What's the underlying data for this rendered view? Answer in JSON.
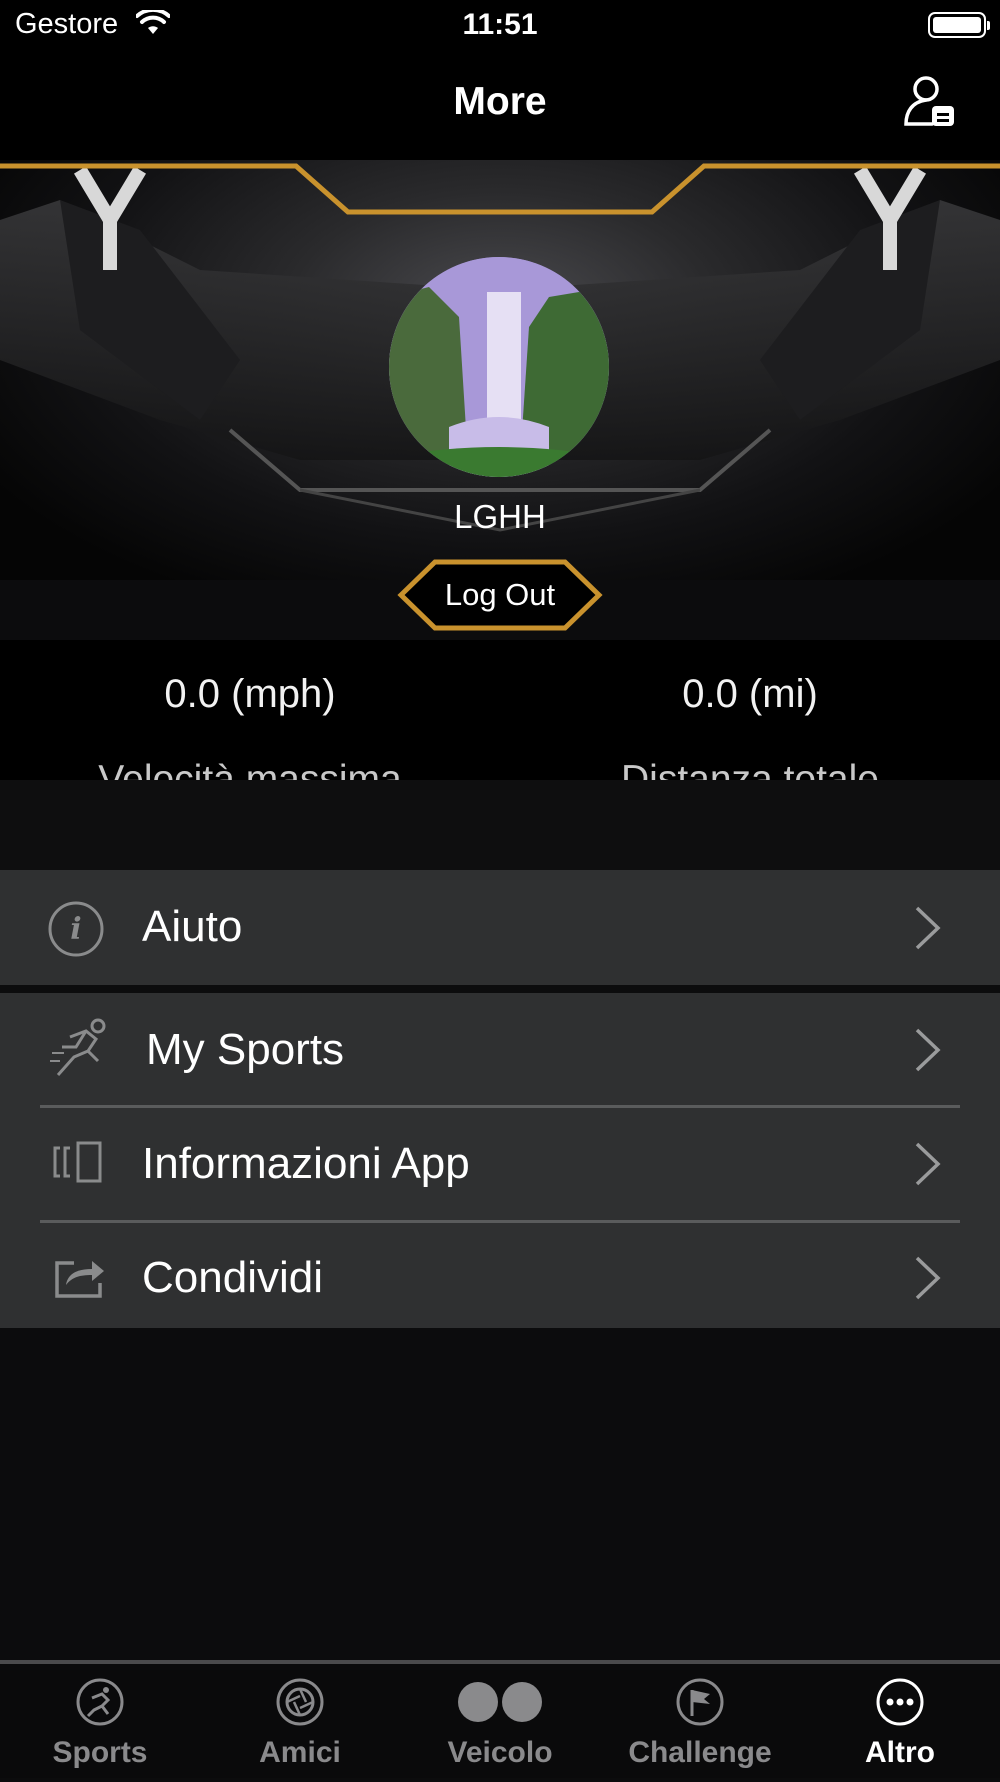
{
  "status_bar": {
    "carrier": "Gestore",
    "time": "11:51"
  },
  "nav": {
    "title": "More"
  },
  "profile": {
    "username": "LGHH",
    "logout_label": "Log Out"
  },
  "stats": [
    {
      "value": "0.0 (mph)",
      "label": "Velocità massima"
    },
    {
      "value": "0.0 (mi)",
      "label": "Distanza totale"
    }
  ],
  "menu": [
    {
      "label": "Aiuto",
      "icon": "info-icon"
    },
    {
      "label": "My Sports",
      "icon": "running-icon"
    },
    {
      "label": "Informazioni App",
      "icon": "app-info-icon"
    },
    {
      "label": "Condividi",
      "icon": "share-icon"
    }
  ],
  "tabs": [
    {
      "label": "Sports",
      "icon": "sports-icon",
      "active": false
    },
    {
      "label": "Amici",
      "icon": "aperture-icon",
      "active": false
    },
    {
      "label": "Veicolo",
      "icon": "vehicle-icon",
      "active": false
    },
    {
      "label": "Challenge",
      "icon": "flag-icon",
      "active": false
    },
    {
      "label": "Altro",
      "icon": "more-icon",
      "active": true
    }
  ],
  "colors": {
    "accent_gold": "#c9922d",
    "menu_bg": "#2f3031",
    "background": "#0c0c0d"
  }
}
